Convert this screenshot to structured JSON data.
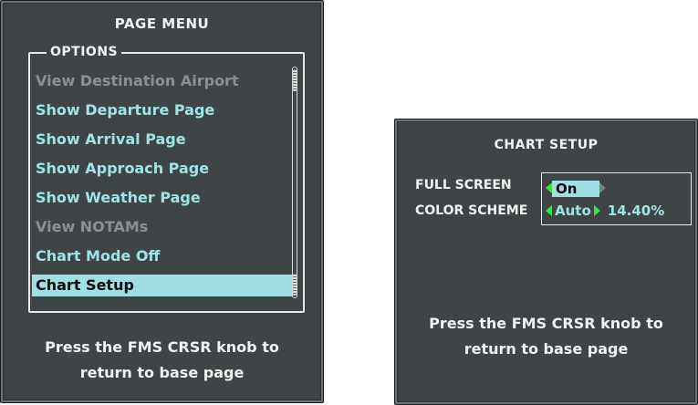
{
  "page_menu": {
    "title": "PAGE MENU",
    "options_label": "OPTIONS",
    "items": [
      {
        "label": "View Destination Airport",
        "enabled": false,
        "selected": false
      },
      {
        "label": "Show Departure Page",
        "enabled": true,
        "selected": false
      },
      {
        "label": "Show Arrival Page",
        "enabled": true,
        "selected": false
      },
      {
        "label": "Show Approach Page",
        "enabled": true,
        "selected": false
      },
      {
        "label": "Show Weather Page",
        "enabled": true,
        "selected": false
      },
      {
        "label": "View NOTAMs",
        "enabled": false,
        "selected": false
      },
      {
        "label": "Chart Mode Off",
        "enabled": true,
        "selected": false
      },
      {
        "label": "Chart Setup",
        "enabled": true,
        "selected": true
      }
    ],
    "footer_line1": "Press the FMS CRSR knob to",
    "footer_line2": "return to base page"
  },
  "chart_setup": {
    "title": "CHART SETUP",
    "full_screen_label": "FULL SCREEN",
    "full_screen_value": "On",
    "color_scheme_label": "COLOR SCHEME",
    "color_scheme_value": "Auto",
    "color_scheme_percent": "14.40%",
    "footer_line1": "Press the FMS CRSR knob to",
    "footer_line2": "return to base page"
  },
  "colors": {
    "window_bg": "#3f4447",
    "menu_text": "#9fe3e7",
    "disabled_text": "#8a8f92",
    "highlight": "#9fdfe3",
    "arrow_green": "#3ce04a"
  },
  "icons": {
    "scroll_thumb": "scrollbar-thumb-icon",
    "value_arrows": [
      "arrow-left-icon",
      "arrow-right-icon"
    ]
  }
}
